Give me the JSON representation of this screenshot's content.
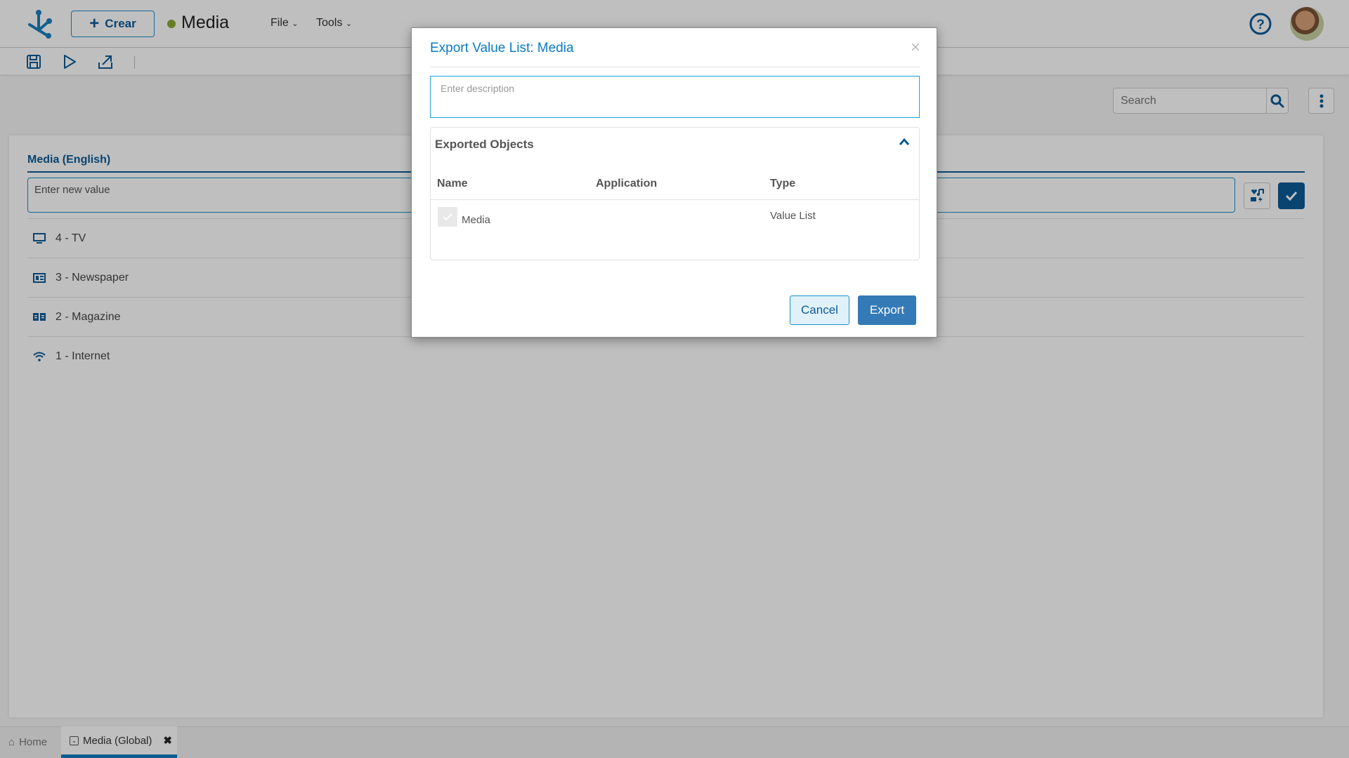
{
  "header": {
    "create_label": "Crear",
    "app_title": "Media",
    "status_color": "#8aa832",
    "menus": [
      "File",
      "Tools"
    ]
  },
  "search": {
    "placeholder": "Search"
  },
  "panel": {
    "label": "Media (English)",
    "new_value_placeholder": "Enter new value",
    "items": [
      {
        "icon": "tv-icon",
        "label": "4 - TV"
      },
      {
        "icon": "newspaper-icon",
        "label": "3 - Newspaper"
      },
      {
        "icon": "book-open-icon",
        "label": "2 - Magazine"
      },
      {
        "icon": "wifi-icon",
        "label": "1 - Internet"
      }
    ]
  },
  "tabs": [
    {
      "label": "Home"
    },
    {
      "label": "Media (Global)"
    }
  ],
  "modal": {
    "title": "Export Value List: Media",
    "description_placeholder": "Enter description",
    "section_title": "Exported Objects",
    "columns": [
      "Name",
      "Application",
      "Type"
    ],
    "rows": [
      {
        "name": "Media",
        "application": "",
        "type": "Value List",
        "checked": true
      }
    ],
    "cancel": "Cancel",
    "export": "Export"
  }
}
